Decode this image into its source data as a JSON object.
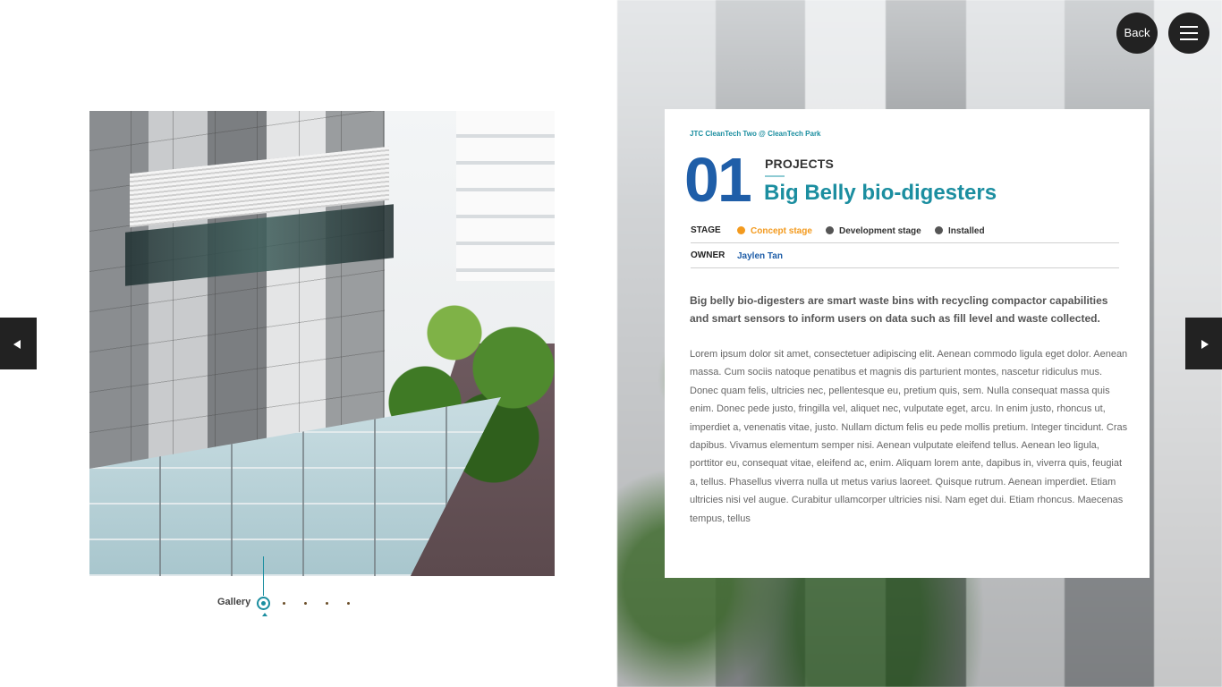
{
  "nav": {
    "back_label": "Back",
    "menu_icon": "hamburger-menu-icon",
    "prev_icon": "arrow-left-icon",
    "next_icon": "arrow-right-icon"
  },
  "gallery": {
    "label": "Gallery",
    "dot_count": 5,
    "active_index": 0
  },
  "project": {
    "site": "JTC CleanTech Two @ CleanTech Park",
    "number": "01",
    "section": "PROJECTS",
    "title": "Big Belly bio-digesters",
    "stage_label": "STAGE",
    "stages": [
      {
        "label": "Concept stage",
        "color": "#f39a1e",
        "active": true
      },
      {
        "label": "Development stage",
        "color": "#555555",
        "active": false
      },
      {
        "label": "Installed",
        "color": "#555555",
        "active": false
      }
    ],
    "owner_label": "OWNER",
    "owner": "Jaylen Tan",
    "lead": "Big belly bio-digesters are smart waste bins with recycling compactor capabilities and smart sensors to inform users on data such as fill level and waste collected.",
    "body": "Lorem ipsum dolor sit amet, consectetuer adipiscing elit. Aenean commodo ligula eget dolor. Aenean massa. Cum sociis natoque penatibus et magnis dis parturient montes, nascetur ridiculus mus. Donec quam felis, ultricies nec, pellentesque eu, pretium quis, sem. Nulla consequat massa quis enim. Donec pede justo, fringilla vel, aliquet nec, vulputate eget, arcu. In enim justo, rhoncus ut, imperdiet a, venenatis vitae, justo. Nullam dictum felis eu pede mollis pretium. Integer tincidunt. Cras dapibus. Vivamus elementum semper nisi. Aenean vulputate eleifend tellus. Aenean leo ligula, porttitor eu, consequat vitae, eleifend ac, enim. Aliquam lorem ante, dapibus in, viverra quis, feugiat a, tellus. Phasellus viverra nulla ut metus varius laoreet. Quisque rutrum. Aenean imperdiet. Etiam ultricies nisi vel augue. Curabitur ullamcorper ultricies nisi. Nam eget dui. Etiam rhoncus. Maecenas tempus, tellus"
  },
  "colors": {
    "accent_teal": "#1b8ea0",
    "accent_blue": "#1f5ea8",
    "stage_active": "#f39a1e",
    "button_dark": "#222222"
  }
}
